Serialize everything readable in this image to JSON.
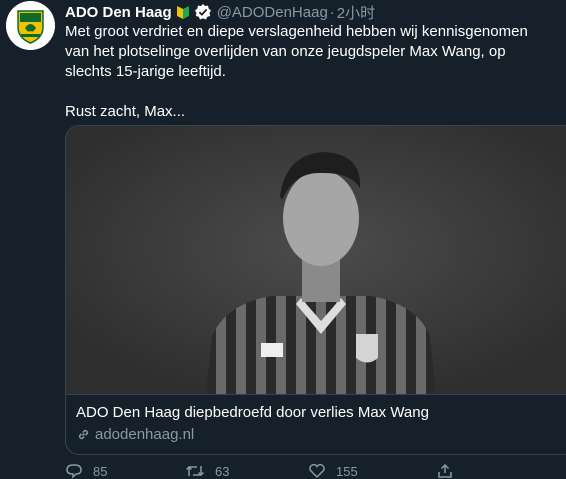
{
  "tweet": {
    "author_name": "ADO Den Haag",
    "author_handle": "@ADODenHaag",
    "separator": "·",
    "time": "2小时",
    "text_lines": [
      "Met groot verdriet en diepe verslagenheid hebben wij kennisgenomen",
      "van het plotselinge overlijden van onze jeugdspeler Max Wang, op",
      "slechts 15-jarige leeftijd.",
      "Rust zacht, Max..."
    ]
  },
  "card": {
    "title": "ADO Den Haag diepbedroefd door verlies Max Wang",
    "url": "adodenhaag.nl",
    "image_icon": "player-photo",
    "link_icon": "link-icon"
  },
  "actions": {
    "reply_count": "85",
    "retweet_count": "63",
    "like_count": "155"
  },
  "colors": {
    "background": "#15202b",
    "text": "#ffffff",
    "secondary": "#8899a6",
    "border": "#38444d",
    "club_yellow": "#f2c200",
    "club_green": "#0a6b2d"
  }
}
